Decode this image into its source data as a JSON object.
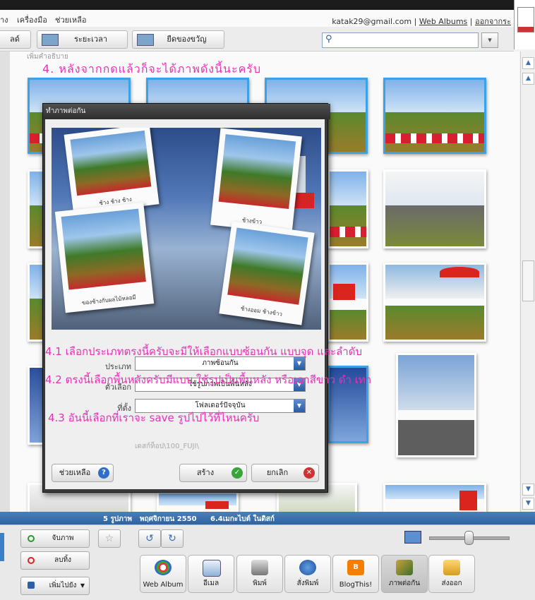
{
  "menu": {
    "items": [
      "าง",
      "เครื่องมือ",
      "ช่วยเหลือ"
    ]
  },
  "account": {
    "email": "katak29@gmail.com",
    "sep1": "|",
    "web_albums": "Web Albums",
    "sep2": "|",
    "signout": "ออกจากระ"
  },
  "toolbar": {
    "btn1": "ลด์",
    "btn2": "ระยะเวลา",
    "btn3": "ยืดของขวัญ",
    "search_placeholder": ""
  },
  "main": {
    "caption_hint": "เพิ่มคำอธิบาย"
  },
  "annotations": {
    "step4": "4.  หลังจากกดแล้วก็จะได้ภาพดังนี้นะครับ",
    "step41": "4.1  เลือกประเภทตรงนี้ครับจะมีให้เลือกแบบซ้อนกัน  แบบจุด  และลำดับ",
    "step42": "4.2  ตรงนี้เลือกพื้นหลังครับมีแบบ  ใช้รูปเป็นพื้นหลัง  หรือเอาสีขาว  ดำ  เทา",
    "step43": "4.3  อันนี้เลือกที่เราจะ  save  รูปไปไว้ที่ไหนครับ"
  },
  "dialog": {
    "title": "ทำภาพต่อกัน",
    "polaroid_caps": [
      "ช้าง ช้าง ช้าง",
      "ช้างข้าว",
      "ของช้างกับผลไม้หลอมี",
      "ช้างออม ช้างข้าว"
    ],
    "type_label": "ประเภท",
    "type_value": "ภาพซ้อนกัน",
    "option_label": "ตัวเลือก",
    "option_value": "ใช้รูปภาพเป็นพื้นหลัง",
    "location_label": "ที่ตั้ง",
    "location_value": "โฟลเดอร์ปัจจุบัน",
    "path_hint": "เดสก์ท็อป\\100_FUJI\\",
    "help": "ช่วยเหลือ",
    "create": "สร้าง",
    "cancel": "ยกเลิก"
  },
  "status": {
    "count": "5 รูปภาพ",
    "date": "พฤศจิกายน 2550",
    "size": "6.4เมกะไบต์ ในดิสก์"
  },
  "tray": {
    "hold": "จับภาพ",
    "remove": "ลบทิ้ง",
    "add_to": "เพิ่มไปยัง",
    "actions": [
      "Web Album",
      "อีเมล",
      "พิมพ์",
      "สั่งพิมพ์",
      "BlogThis!",
      "ภาพต่อกัน",
      "ส่งออก"
    ]
  },
  "colors": {
    "accent": "#3ba2e6",
    "annotation": "#e830b8",
    "status_bar": "#2f62a0"
  }
}
